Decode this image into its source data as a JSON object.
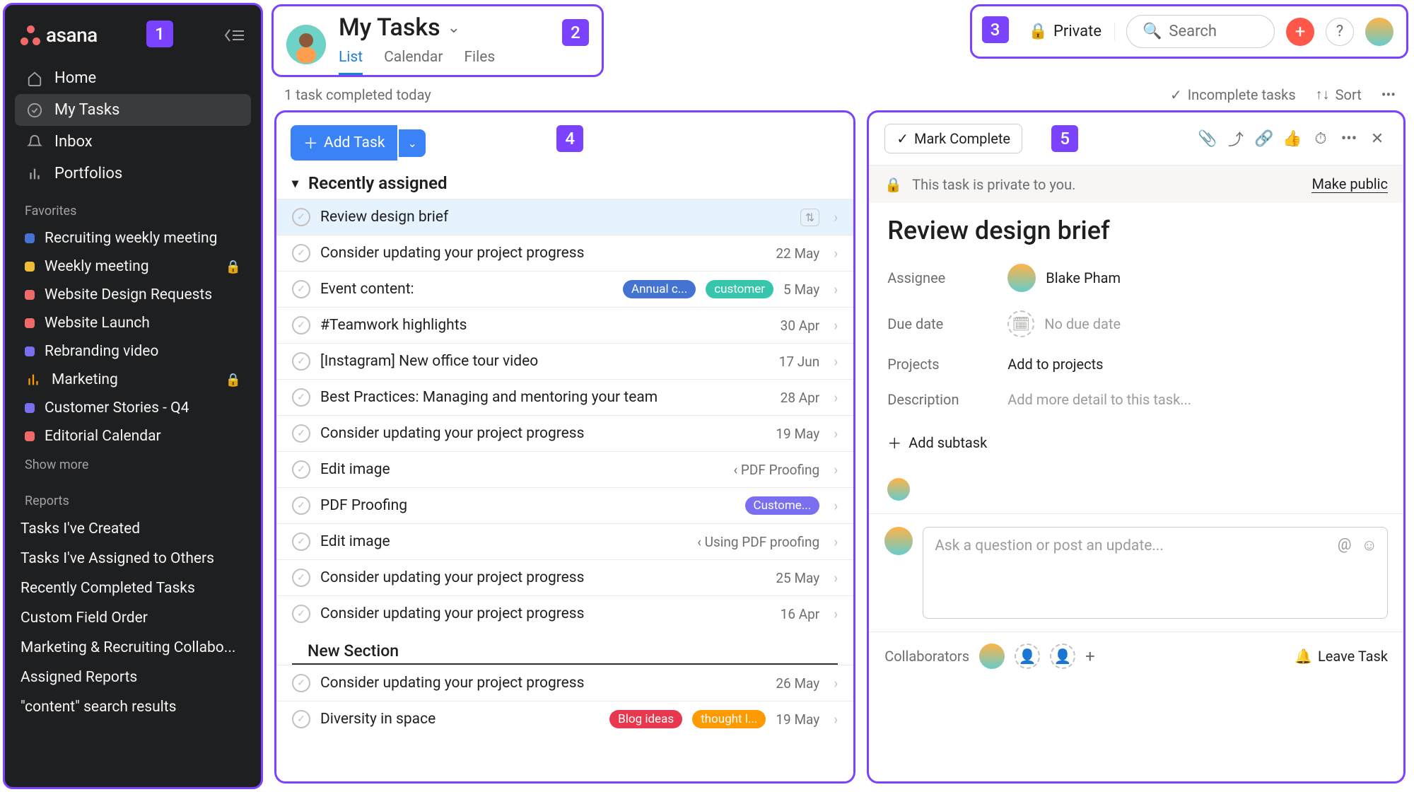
{
  "annotations": {
    "sidebar": "1",
    "header": "2",
    "topbar": "3",
    "tasks": "4",
    "detail": "5"
  },
  "logo_text": "asana",
  "nav": [
    {
      "icon": "home",
      "label": "Home"
    },
    {
      "icon": "check",
      "label": "My Tasks",
      "active": true
    },
    {
      "icon": "bell",
      "label": "Inbox"
    },
    {
      "icon": "bars",
      "label": "Portfolios"
    }
  ],
  "favorites_label": "Favorites",
  "favorites": [
    {
      "color": "#4573d2",
      "label": "Recruiting weekly meeting"
    },
    {
      "color": "#f1bd37",
      "label": "Weekly meeting",
      "locked": true
    },
    {
      "color": "#f06a6a",
      "label": "Website Design Requests"
    },
    {
      "color": "#f06a6a",
      "label": "Website Launch"
    },
    {
      "color": "#7a6ff0",
      "label": "Rebranding video"
    },
    {
      "color": "bars",
      "label": "Marketing",
      "locked": true,
      "icon": "bars"
    },
    {
      "color": "#7a6ff0",
      "label": "Customer Stories - Q4"
    },
    {
      "color": "#f06a6a",
      "label": "Editorial Calendar"
    }
  ],
  "show_more": "Show more",
  "reports_label": "Reports",
  "reports": [
    "Tasks I've Created",
    "Tasks I've Assigned to Others",
    "Recently Completed Tasks",
    "Custom Field Order",
    "Marketing & Recruiting Collabo...",
    "Assigned Reports",
    "\"content\" search results"
  ],
  "header": {
    "title": "My Tasks",
    "tabs": [
      {
        "label": "List",
        "active": true
      },
      {
        "label": "Calendar"
      },
      {
        "label": "Files"
      }
    ]
  },
  "topbar": {
    "private": "Private",
    "search_placeholder": "Search"
  },
  "status_text": "1 task completed today",
  "filters": {
    "incomplete": "Incomplete tasks",
    "sort": "Sort"
  },
  "add_task": "Add Task",
  "section_recent": "Recently assigned",
  "tasks": [
    {
      "title": "Review design brief",
      "selected": true,
      "detailsIcon": true
    },
    {
      "title": "Consider updating your project progress",
      "date": "22 May"
    },
    {
      "title": "Event content:",
      "tags": [
        {
          "t": "Annual c...",
          "c": "blue"
        },
        {
          "t": "customer",
          "c": "teal"
        }
      ],
      "date": "5 May"
    },
    {
      "title": "#Teamwork highlights",
      "date": "30 Apr"
    },
    {
      "title": "[Instagram] New office tour video",
      "date": "17 Jun"
    },
    {
      "title": "Best Practices: Managing and mentoring your team",
      "date": "28 Apr"
    },
    {
      "title": "Consider updating your project progress",
      "date": "19 May"
    },
    {
      "title": "Edit image",
      "sub": "‹ PDF Proofing"
    },
    {
      "title": "PDF Proofing",
      "tags": [
        {
          "t": "Custome...",
          "c": "purple"
        }
      ]
    },
    {
      "title": "Edit image",
      "sub": "‹ Using PDF proofing"
    },
    {
      "title": "Consider updating your project progress",
      "date": "25 May"
    },
    {
      "title": "Consider updating your project progress",
      "date": "16 Apr"
    }
  ],
  "new_section": "New Section",
  "tasks2": [
    {
      "title": "Consider updating your project progress",
      "date": "26 May"
    },
    {
      "title": "Diversity in space",
      "tags": [
        {
          "t": "Blog ideas",
          "c": "red"
        },
        {
          "t": "thought l...",
          "c": "orange"
        }
      ],
      "date": "19 May"
    }
  ],
  "detail": {
    "mark_complete": "Mark Complete",
    "privacy_msg": "This task is private to you.",
    "make_public": "Make public",
    "title": "Review design brief",
    "assignee_label": "Assignee",
    "assignee_name": "Blake Pham",
    "due_label": "Due date",
    "due_placeholder": "No due date",
    "projects_label": "Projects",
    "projects_placeholder": "Add to projects",
    "desc_label": "Description",
    "desc_placeholder": "Add more detail to this task...",
    "add_subtask": "Add subtask",
    "comment_placeholder": "Ask a question or post an update...",
    "collaborators": "Collaborators",
    "leave": "Leave Task"
  }
}
